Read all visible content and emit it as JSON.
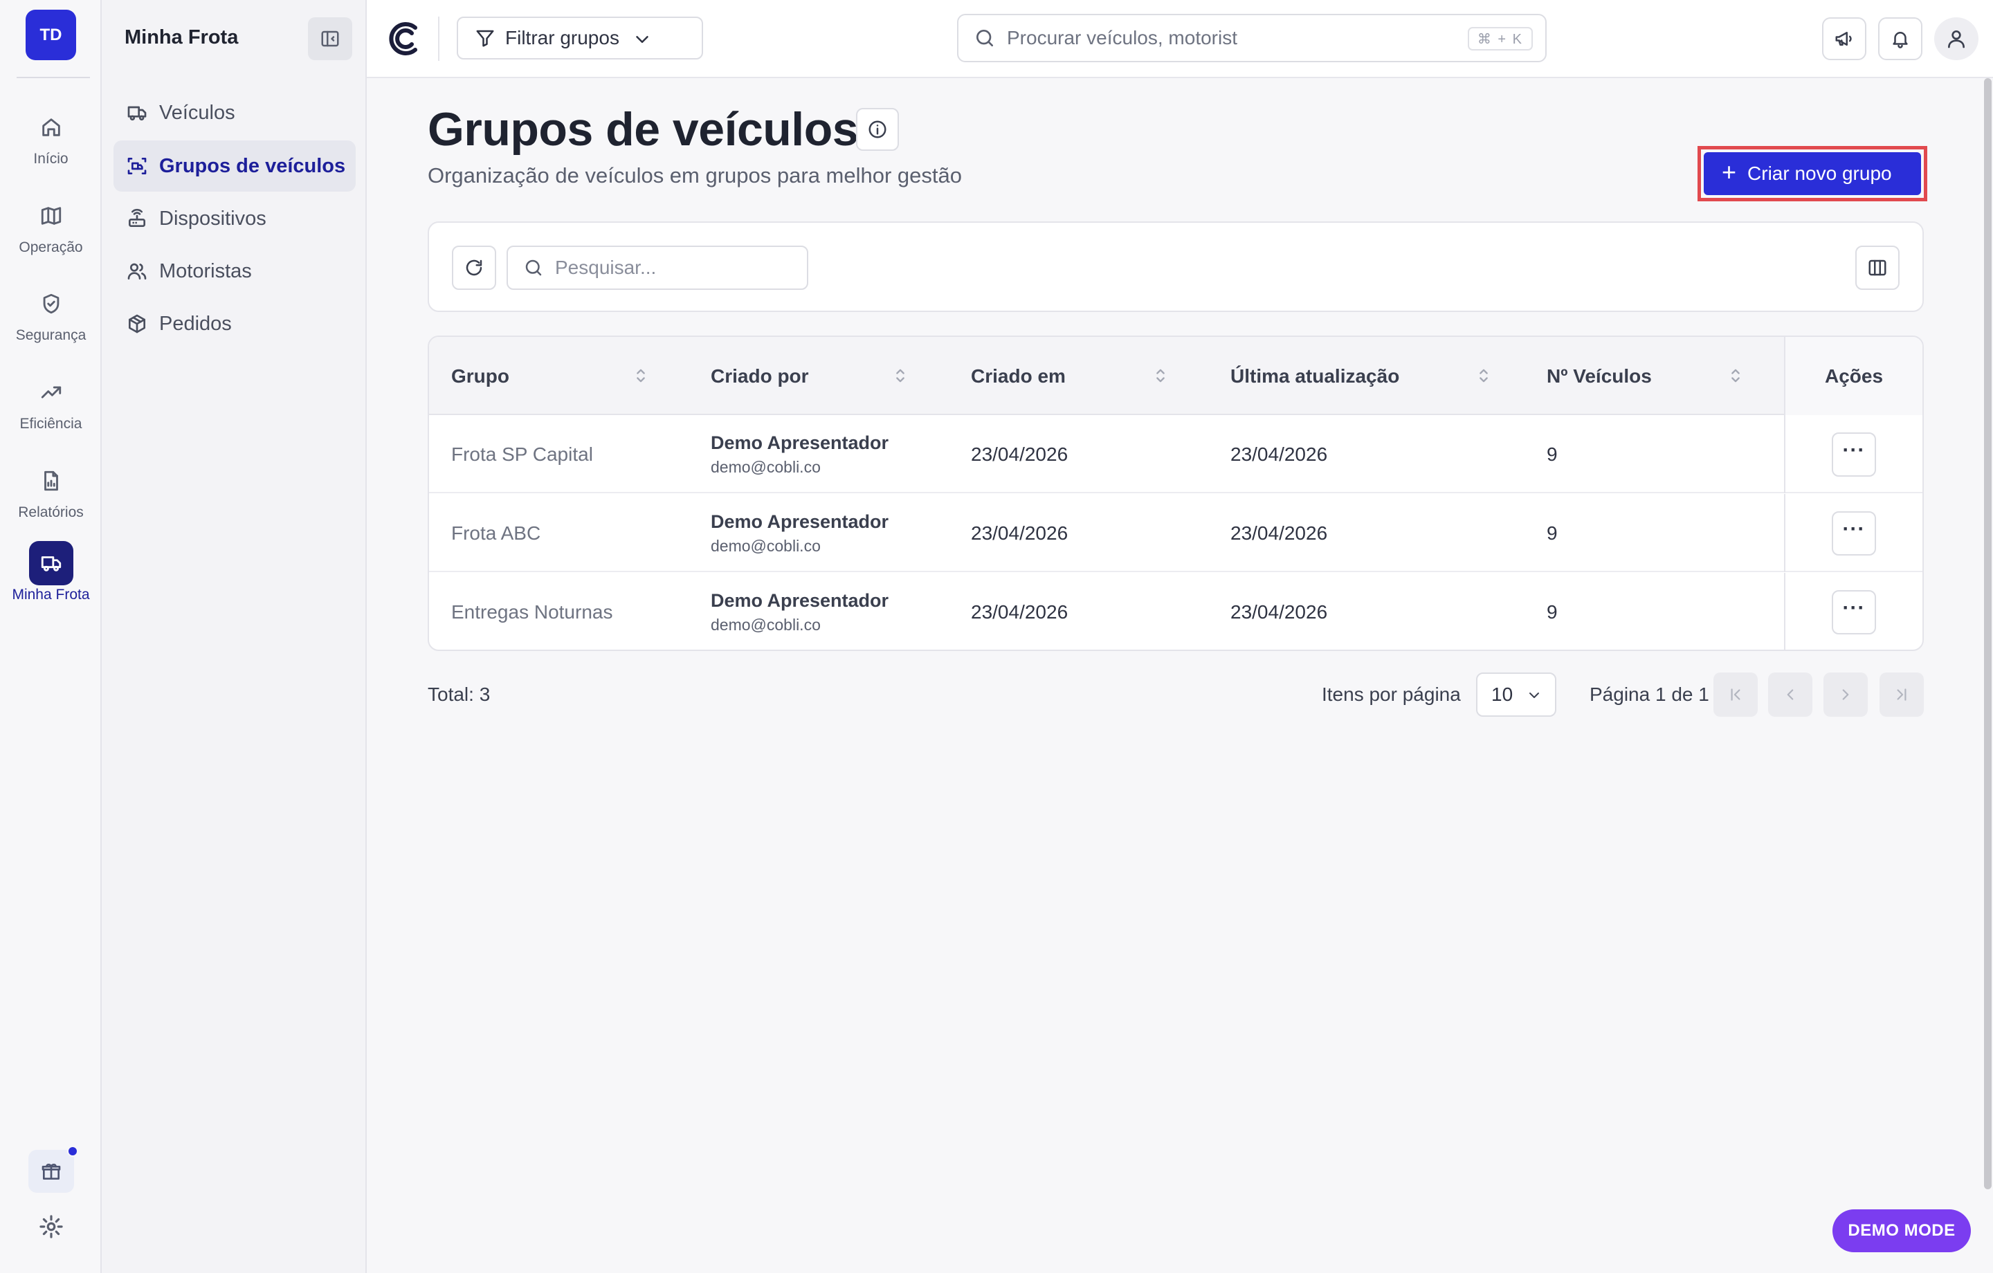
{
  "user": {
    "initials": "TD"
  },
  "rail": {
    "items": [
      {
        "label": "Início",
        "icon": "home-icon"
      },
      {
        "label": "Operação",
        "icon": "map-icon"
      },
      {
        "label": "Segurança",
        "icon": "shield-icon"
      },
      {
        "label": "Eficiência",
        "icon": "trend-up-icon"
      },
      {
        "label": "Relatórios",
        "icon": "report-icon"
      },
      {
        "label": "Minha Frota",
        "icon": "truck-icon",
        "active": true
      }
    ]
  },
  "subnav": {
    "title": "Minha Frota",
    "items": [
      {
        "label": "Veículos",
        "icon": "truck-icon"
      },
      {
        "label": "Grupos de veículos",
        "icon": "group-scan-icon",
        "active": true
      },
      {
        "label": "Dispositivos",
        "icon": "device-icon"
      },
      {
        "label": "Motoristas",
        "icon": "users-icon"
      },
      {
        "label": "Pedidos",
        "icon": "package-icon"
      }
    ]
  },
  "topbar": {
    "filter_label": "Filtrar grupos",
    "search_placeholder": "Procurar veículos, motorist",
    "search_shortcut": "⌘ + K"
  },
  "main": {
    "title": "Grupos de veículos",
    "subtitle": "Organização de veículos em grupos para melhor gestão",
    "create_label": "Criar novo grupo",
    "table_search_placeholder": "Pesquisar...",
    "columns": {
      "group": "Grupo",
      "created_by": "Criado por",
      "created_at": "Criado em",
      "updated_at": "Última atualização",
      "vehicles": "Nº Veículos",
      "actions": "Ações"
    },
    "rows": [
      {
        "group": "Frota SP Capital",
        "creator_name": "Demo Apresentador",
        "creator_email": "demo@cobli.co",
        "created_at": "23/04/2026",
        "updated_at": "23/04/2026",
        "vehicles": "9",
        "more": "···"
      },
      {
        "group": "Frota ABC",
        "creator_name": "Demo Apresentador",
        "creator_email": "demo@cobli.co",
        "created_at": "23/04/2026",
        "updated_at": "23/04/2026",
        "vehicles": "9",
        "more": "···"
      },
      {
        "group": "Entregas Noturnas",
        "creator_name": "Demo Apresentador",
        "creator_email": "demo@cobli.co",
        "created_at": "23/04/2026",
        "updated_at": "23/04/2026",
        "vehicles": "9",
        "more": "···"
      }
    ],
    "total_label": "Total: 3",
    "items_per_page_label": "Itens por página",
    "items_per_page_value": "10",
    "page_label": "Página 1 de 1"
  },
  "demo_badge": "DEMO MODE",
  "colors": {
    "accent": "#2a2ed8",
    "active_nav": "#1d1f9a",
    "highlight_border": "#e14a4f",
    "demo_badge": "#7b3df0"
  }
}
